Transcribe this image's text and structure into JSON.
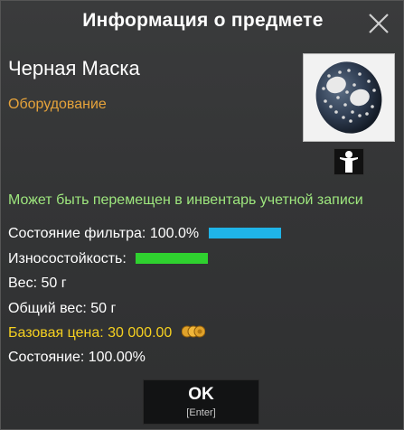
{
  "dialog": {
    "title": "Информация о предмете",
    "close_icon": "close-icon"
  },
  "item": {
    "name": "Черная Маска",
    "category": "Оборудование",
    "image_icon": "hockey-mask-icon",
    "equip_icon": "character-equip-icon",
    "bindable_text": "Может быть перемещен в инвентарь учетной записи"
  },
  "stats": {
    "filter_label": "Состояние фильтра:",
    "filter_value": "100.0%",
    "filter_fraction": 1.0,
    "durability_label": "Износостойкость:",
    "durability_fraction": 1.0,
    "weight_label": "Вес:",
    "weight_value": "50 г",
    "total_weight_label": "Общий вес:",
    "total_weight_value": "50 г",
    "price_label": "Базовая цена:",
    "price_value": "30 000.00",
    "price_icon": "coins-icon",
    "condition_label": "Состояние:",
    "condition_value": "100.00%"
  },
  "footer": {
    "ok_label": "OK",
    "ok_hint": "[Enter]"
  },
  "colors": {
    "category": "#e6a33a",
    "bindable": "#9ee77e",
    "price": "#f5d020",
    "filter_bar": "#1fb4e8",
    "durability_bar": "#2fd12f"
  }
}
